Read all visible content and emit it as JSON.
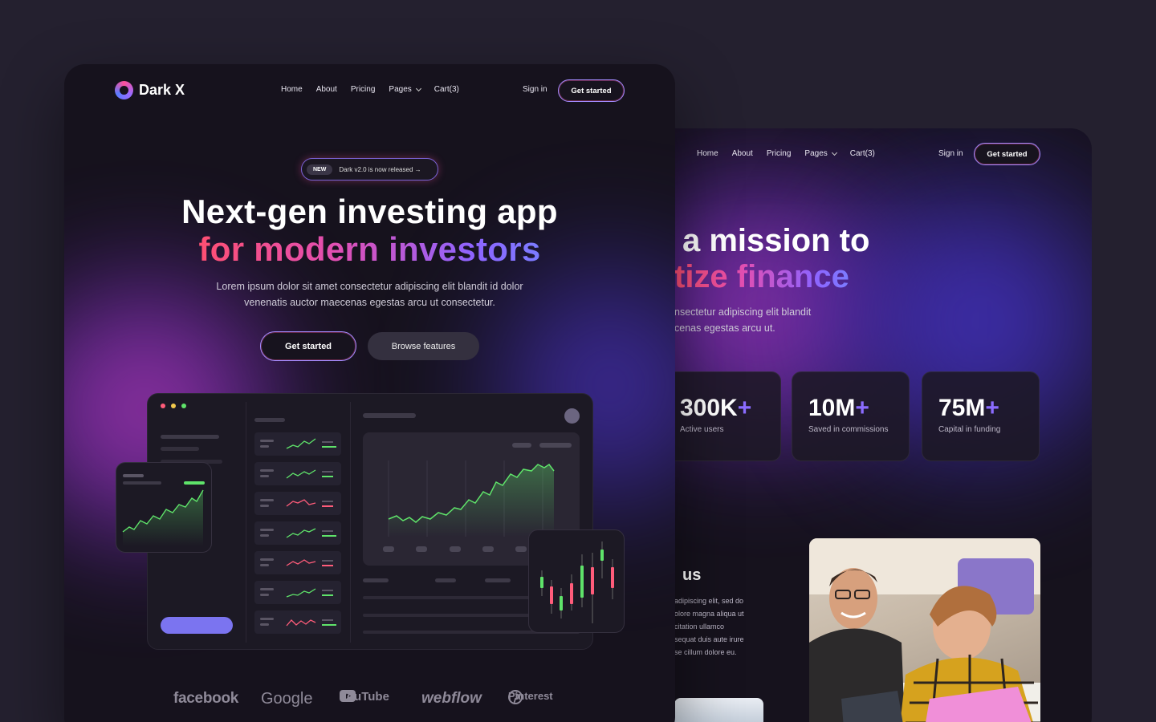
{
  "front": {
    "brand": "Dark X",
    "nav": [
      "Home",
      "About",
      "Pricing",
      "Pages",
      "Cart(3)"
    ],
    "sign_in": "Sign in",
    "cta": "Get started",
    "badge_tag": "NEW",
    "badge_text": "Dark v2.0 is now released →",
    "headline_1": "Next-gen investing app",
    "headline_2": "for modern investors",
    "subtitle_1": "Lorem ipsum dolor sit amet consectetur adipiscing elit blandit id dolor",
    "subtitle_2": "venenatis auctor maecenas egestas arcu ut consectetur.",
    "btn_primary": "Get started",
    "btn_secondary": "Browse features",
    "partners": [
      "facebook",
      "Google",
      "YouTube",
      "webflow",
      "Pinterest"
    ]
  },
  "back": {
    "nav": [
      "Home",
      "About",
      "Pricing",
      "Pages",
      "Cart(3)"
    ],
    "sign_in": "Sign in",
    "cta": "Get started",
    "headline_1": "a mission to",
    "headline_2": "tize finance",
    "subtitle_1": "nsectetur adipiscing elit blandit",
    "subtitle_2": "cenas egestas arcu ut.",
    "stats": [
      {
        "value": "300K",
        "suffix": "+",
        "label": "Active users"
      },
      {
        "value": "10M",
        "suffix": "+",
        "label": "Saved in commissions"
      },
      {
        "value": "75M",
        "suffix": "+",
        "label": "Capital in funding"
      }
    ],
    "about_heading": "us",
    "about_lines": [
      "adipiscing elit, sed do",
      "olore magna aliqua ut",
      "citation ullamco",
      "sequat duis aute irure",
      "se cillum dolore eu."
    ]
  },
  "colors": {
    "accent": "#8b6cff",
    "pink": "#ff4f9a",
    "up": "#5fe36a",
    "down": "#ff5c7a",
    "bg": "#16121d"
  }
}
